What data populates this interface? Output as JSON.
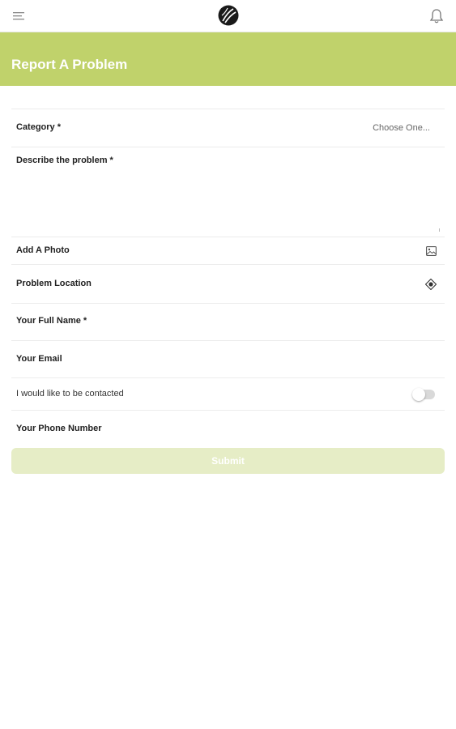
{
  "header": {
    "menu_icon": "menu-icon",
    "logo_icon": "globe-logo-icon",
    "bell_icon": "bell-icon"
  },
  "banner": {
    "title": "Report A Problem",
    "color": "#c0d26b"
  },
  "form": {
    "category": {
      "label": "Category *",
      "value": "Choose One..."
    },
    "description": {
      "label": "Describe the problem *"
    },
    "photo": {
      "label": "Add A Photo",
      "icon": "image-icon"
    },
    "location": {
      "label": "Problem Location",
      "icon": "location-target-icon"
    },
    "full_name": {
      "label": "Your Full Name *"
    },
    "email": {
      "label": "Your Email"
    },
    "contact": {
      "label": "I would like to be contacted",
      "enabled": false
    },
    "phone": {
      "label": "Your Phone Number"
    },
    "submit_label": "Submit",
    "submit_color": "#e6edc6"
  }
}
